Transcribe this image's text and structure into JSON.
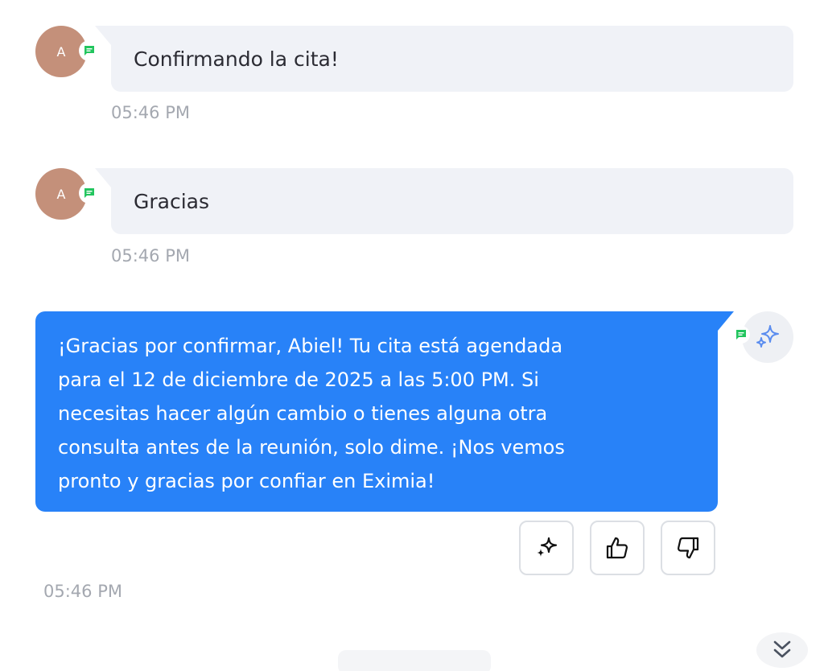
{
  "messages": [
    {
      "avatar_initial": "A",
      "text": "Confirmando la cita!",
      "time": "05:46 PM"
    },
    {
      "avatar_initial": "A",
      "text": "Gracias",
      "time": "05:46 PM"
    }
  ],
  "bot_reply": {
    "lines": [
      "¡Gracias por confirmar, Abiel! Tu cita está agendada",
      "para el 12 de diciembre de 2025 a las 5:00 PM. Si",
      "necesitas hacer algún cambio o tienes alguna otra",
      "consulta antes de la reunión, solo dime. ¡Nos vemos",
      "pronto y gracias por confiar en Eximia!"
    ],
    "time": "05:46 PM",
    "avatar_icon": "sparkle-icon",
    "actions": [
      {
        "icon": "sparkle-icon"
      },
      {
        "icon": "thumbs-up-icon"
      },
      {
        "icon": "thumbs-down-icon"
      }
    ]
  },
  "colors": {
    "user_avatar": "#c4907a",
    "incoming_bubble": "#f0f2f7",
    "outgoing_bubble": "#2882f8",
    "channel_badge": "#22c55e",
    "timestamp": "#a4a8b0"
  },
  "scroll_button": {
    "icon": "double-chevron-down-icon"
  }
}
